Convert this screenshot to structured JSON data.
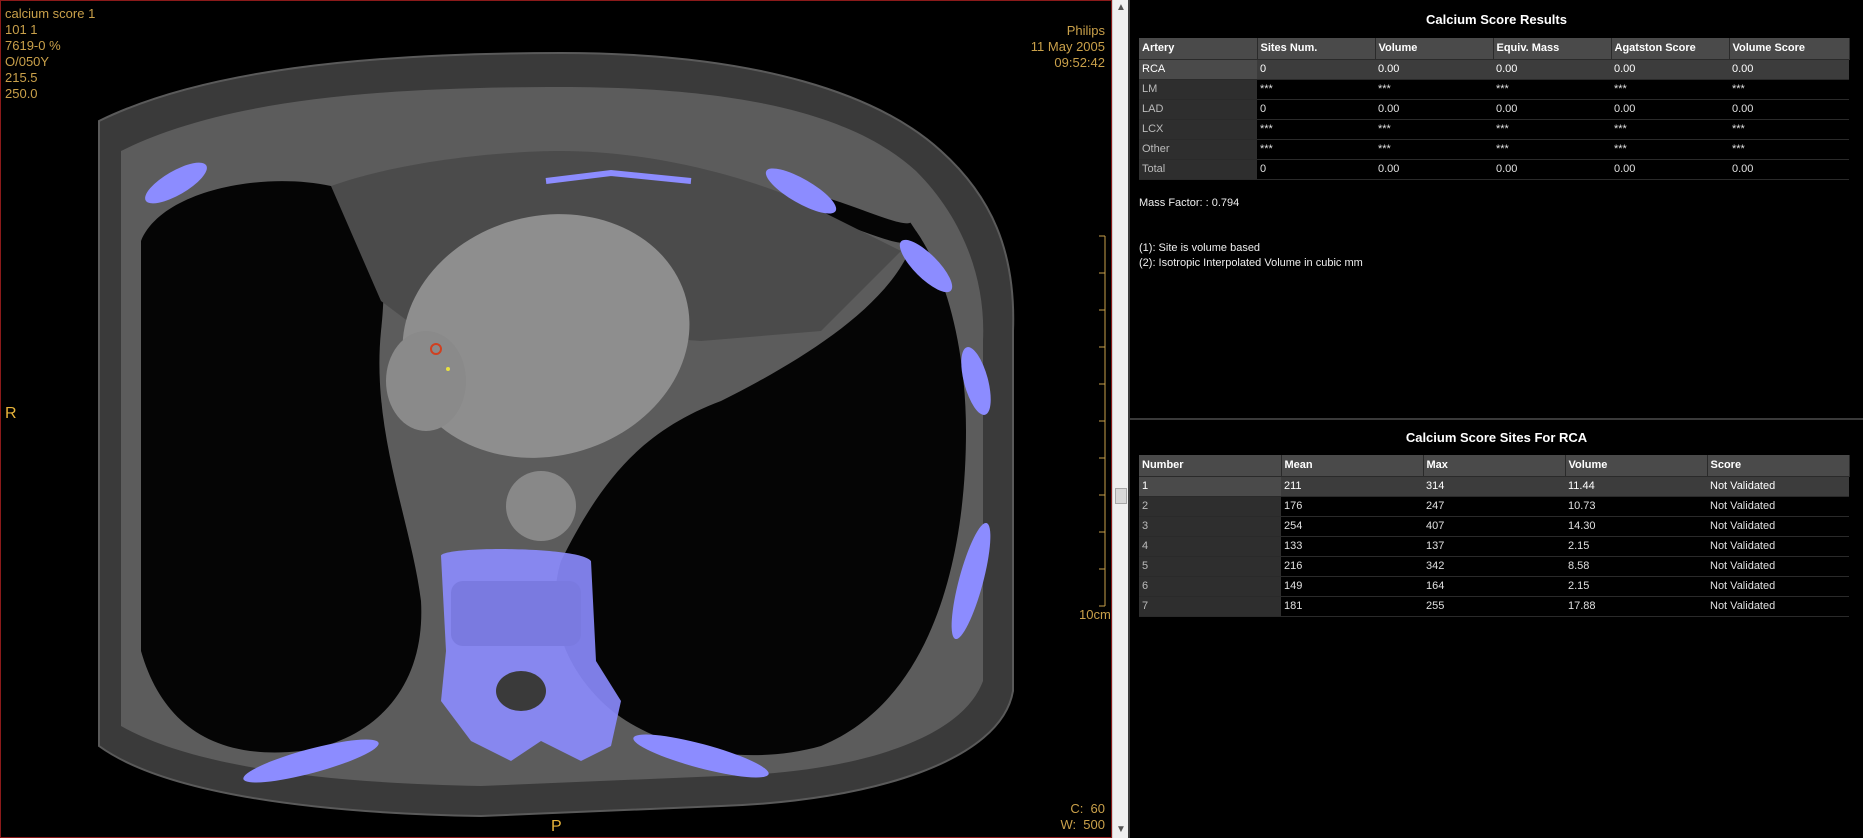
{
  "viewer": {
    "overlay_top_left": [
      "calcium score 1",
      "101 1",
      "7619-0 %",
      "O/050Y",
      "215.5",
      "250.0"
    ],
    "overlay_top_right": [
      "Philips",
      "11 May 2005",
      "09:52:42"
    ],
    "overlay_bottom_right": [
      "C:  60",
      "W:  500"
    ],
    "orientation_left": "R",
    "orientation_bottom": "P",
    "scale_label": "10cm",
    "colors": {
      "overlay_text": "#c9a04a",
      "bone_overlay": "#8c8cff",
      "frame": "#8b1a1a"
    }
  },
  "results": {
    "title": "Calcium Score Results",
    "columns": [
      "Artery",
      "Sites Num.",
      "Volume",
      "Equiv. Mass",
      "Agatston Score",
      "Volume Score"
    ],
    "rows": [
      [
        "RCA",
        "0",
        "0.00",
        "0.00",
        "0.00",
        "0.00"
      ],
      [
        "LM",
        "***",
        "***",
        "***",
        "***",
        "***"
      ],
      [
        "LAD",
        "0",
        "0.00",
        "0.00",
        "0.00",
        "0.00"
      ],
      [
        "LCX",
        "***",
        "***",
        "***",
        "***",
        "***"
      ],
      [
        "Other",
        "***",
        "***",
        "***",
        "***",
        "***"
      ],
      [
        "Total",
        "0",
        "0.00",
        "0.00",
        "0.00",
        "0.00"
      ]
    ],
    "mass_factor": "Mass Factor: : 0.794",
    "notes": [
      "(1): Site is volume based",
      "(2): Isotropic Interpolated Volume in cubic mm"
    ]
  },
  "sites": {
    "title": "Calcium Score Sites For RCA",
    "columns": [
      "Number",
      "Mean",
      "Max",
      "Volume",
      "Score"
    ],
    "rows": [
      [
        "1",
        "211",
        "314",
        "11.44",
        "Not Validated"
      ],
      [
        "2",
        "176",
        "247",
        "10.73",
        "Not Validated"
      ],
      [
        "3",
        "254",
        "407",
        "14.30",
        "Not Validated"
      ],
      [
        "4",
        "133",
        "137",
        "2.15",
        "Not Validated"
      ],
      [
        "5",
        "216",
        "342",
        "8.58",
        "Not Validated"
      ],
      [
        "6",
        "149",
        "164",
        "2.15",
        "Not Validated"
      ],
      [
        "7",
        "181",
        "255",
        "17.88",
        "Not Validated"
      ]
    ]
  }
}
